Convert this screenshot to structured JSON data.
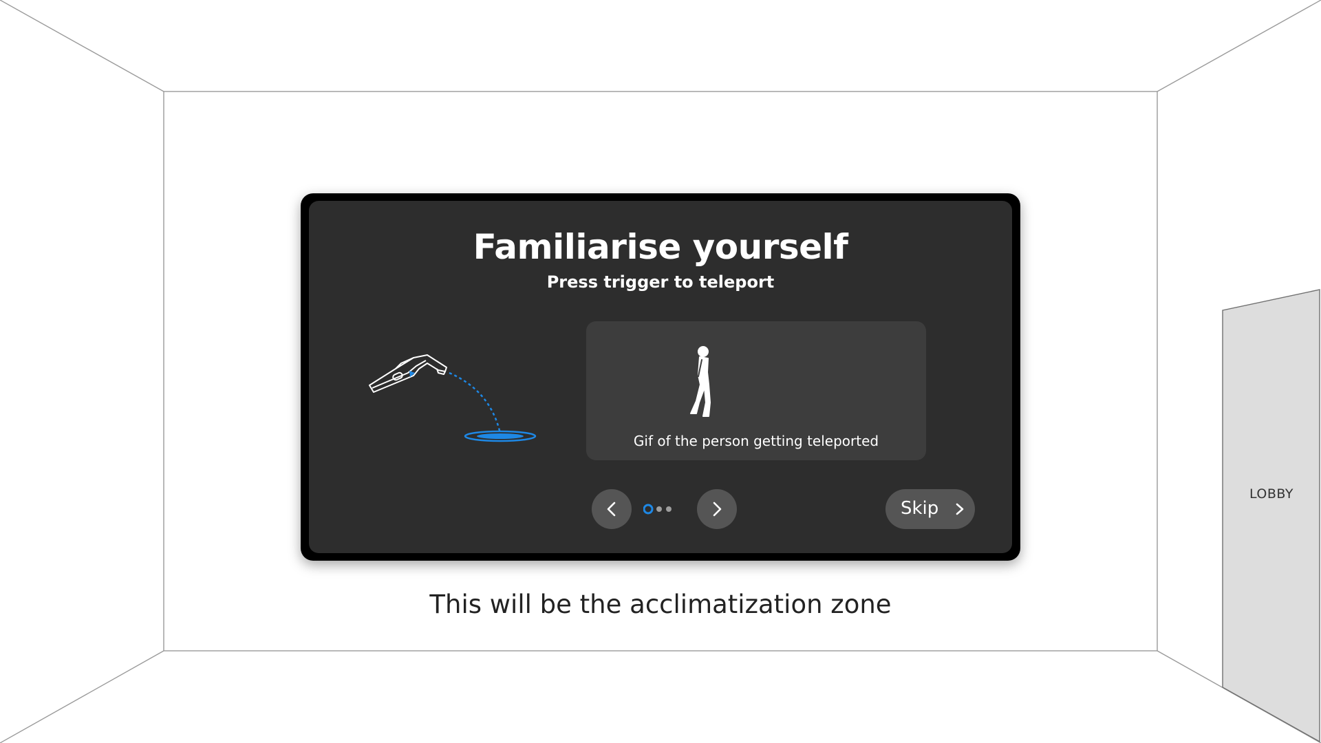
{
  "tutorial_card": {
    "title": "Familiarise yourself",
    "subtitle": "Press trigger to teleport",
    "gif_caption": "Gif of the person getting teleported",
    "skip_label": "Skip",
    "pagination": {
      "total_pages": 3,
      "current_page": 1
    }
  },
  "room": {
    "zone_caption": "This will be the acclimatization zone",
    "door_label": "LOBBY"
  },
  "icons": {
    "prev": "chevron-left-icon",
    "next": "chevron-right-icon",
    "skip": "chevron-right-icon",
    "controller": "vr-controller-icon",
    "teleport_target": "teleport-target-icon",
    "person": "walking-person-icon"
  },
  "colors": {
    "panel_background": "#2d2d2d",
    "panel_border": "#000000",
    "card_background": "#3d3d3d",
    "button_background": "#555555",
    "accent_blue": "#1e88e5",
    "inactive_dot": "#9e9e9e",
    "text_light": "#ffffff",
    "caption_text": "#222222",
    "door_fill": "#dddddd"
  }
}
